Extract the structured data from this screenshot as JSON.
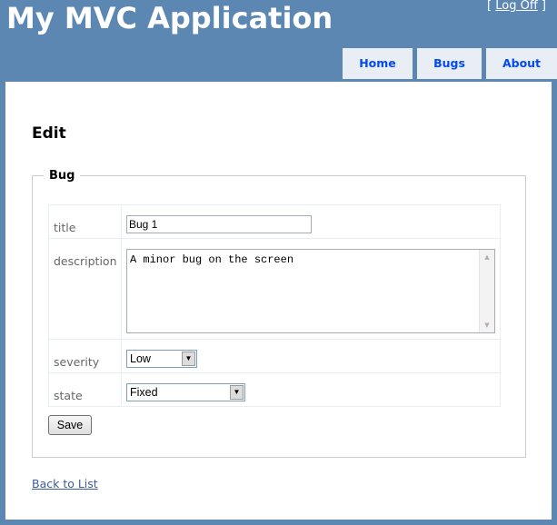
{
  "header": {
    "app_title": "My MVC Application",
    "login_open": "[ ",
    "logoff_label": "Log Off",
    "login_close": " ]"
  },
  "menu": {
    "items": [
      {
        "label": "Home"
      },
      {
        "label": "Bugs"
      },
      {
        "label": "About"
      }
    ]
  },
  "main": {
    "page_title": "Edit",
    "fieldset_legend": "Bug",
    "fields": {
      "title": {
        "label": "title",
        "value": "Bug 1"
      },
      "description": {
        "label": "description",
        "value": "A minor bug on the screen"
      },
      "severity": {
        "label": "severity",
        "value": "Low"
      },
      "state": {
        "label": "state",
        "value": "Fixed"
      }
    },
    "save_label": "Save",
    "back_link": "Back to List"
  },
  "colors": {
    "page_background": "#5c87b2",
    "menu_tab": "#e8eef4",
    "menu_text": "#034af3",
    "link": "#3c5c9b"
  },
  "icons": {
    "dropdown": "chevron-down-icon",
    "scroll_up": "scroll-up-icon",
    "scroll_down": "scroll-down-icon"
  }
}
